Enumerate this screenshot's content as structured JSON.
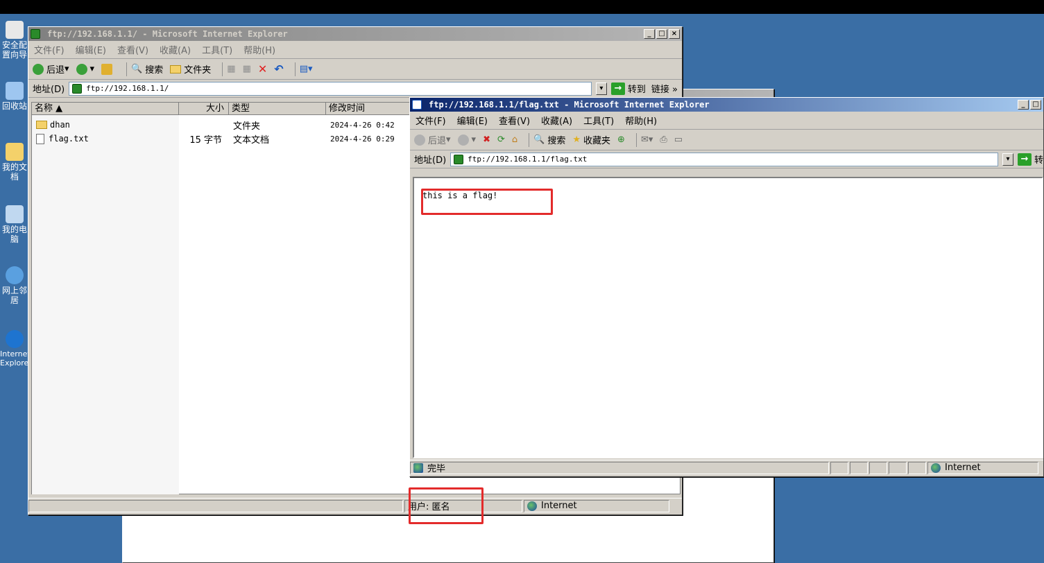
{
  "desktop": {
    "icons": [
      {
        "label": "安全配置向导",
        "icon": "security-wizard-icon"
      },
      {
        "label": "回收站",
        "icon": "recycle-bin-icon"
      },
      {
        "label": "我的文档",
        "icon": "my-documents-icon"
      },
      {
        "label": "我的电脑",
        "icon": "my-computer-icon"
      },
      {
        "label": "网上邻居",
        "icon": "network-places-icon"
      },
      {
        "label": "Internet Explorer",
        "icon": "internet-explorer-icon"
      }
    ]
  },
  "ftp_window": {
    "title": "ftp://192.168.1.1/ - Microsoft Internet Explorer",
    "menu": [
      "文件(F)",
      "编辑(E)",
      "查看(V)",
      "收藏(A)",
      "工具(T)",
      "帮助(H)"
    ],
    "toolbar": {
      "back": "后退",
      "search": "搜索",
      "folders": "文件夹"
    },
    "address_label": "地址(D)",
    "address": "ftp://192.168.1.1/",
    "go_label": "转到",
    "links_label": "链接 »",
    "columns": [
      "名称 ▲",
      "大小",
      "类型",
      "修改时间"
    ],
    "files": [
      {
        "name": "dhan",
        "size": "",
        "type": "文件夹",
        "modified": "2024-4-26 0:42",
        "icon": "folder-icon"
      },
      {
        "name": "flag.txt",
        "size": "15 字节",
        "type": "文本文档",
        "modified": "2024-4-26 0:29",
        "icon": "text-file-icon"
      }
    ],
    "status": {
      "user": "用户: 匿名",
      "zone": "Internet"
    }
  },
  "flag_window": {
    "title": "ftp://192.168.1.1/flag.txt - Microsoft Internet Explorer",
    "menu": [
      "文件(F)",
      "编辑(E)",
      "查看(V)",
      "收藏(A)",
      "工具(T)",
      "帮助(H)"
    ],
    "toolbar": {
      "back": "后退",
      "search": "搜索",
      "favorites": "收藏夹"
    },
    "address_label": "地址(D)",
    "address": "ftp://192.168.1.1/flag.txt",
    "go_label": "转",
    "content": "this is a flag!",
    "status": {
      "done": "完毕",
      "zone": "Internet"
    }
  },
  "colors": {
    "desktop": "#3a6ea5",
    "highlight": "#e32b2b",
    "active_title": "#0a246a"
  }
}
